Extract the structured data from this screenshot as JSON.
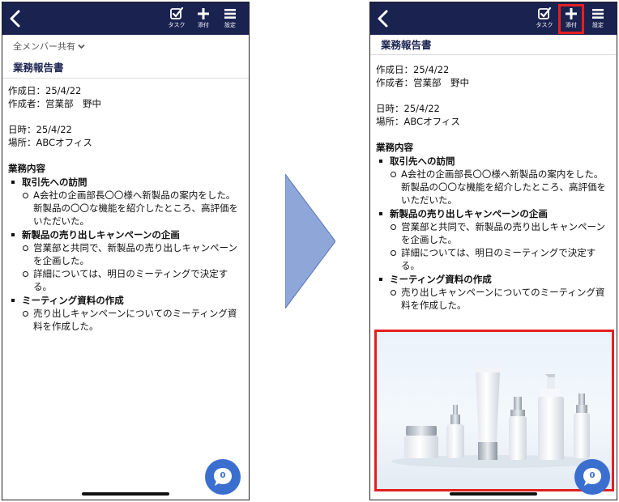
{
  "toolbar": {
    "task_label": "タスク",
    "attach_label": "添付",
    "settings_label": "設定"
  },
  "share_filter": {
    "label": "全メンバー共有"
  },
  "document": {
    "title": "業務報告書",
    "created_date": "作成日：25/4/22",
    "author": "作成者：営業部　野中",
    "datetime": "日時：25/4/22",
    "place": "場所：ABCオフィス",
    "section_heading": "業務内容",
    "topics": [
      {
        "title": "取引先への訪問",
        "details": [
          "A会社の企画部長〇〇様へ新製品の案内をした。新製品の〇〇な機能を紹介したところ、高評価をいただいた。"
        ]
      },
      {
        "title": "新製品の売り出しキャンペーンの企画",
        "details": [
          "営業部と共同で、新製品の売り出しキャンペーンを企画した。",
          "詳細については、明日のミーティングで決定する。"
        ]
      },
      {
        "title": "ミーティング資料の作成",
        "details": [
          "売り出しキャンペーンについてのミーティング資料を作成した。"
        ]
      }
    ]
  },
  "chat": {
    "count": "0"
  },
  "colors": {
    "topbar": "#1a2250",
    "highlight": "#e32020",
    "chat_button": "#3a6fd0",
    "arrow": "#8ea6d8"
  }
}
